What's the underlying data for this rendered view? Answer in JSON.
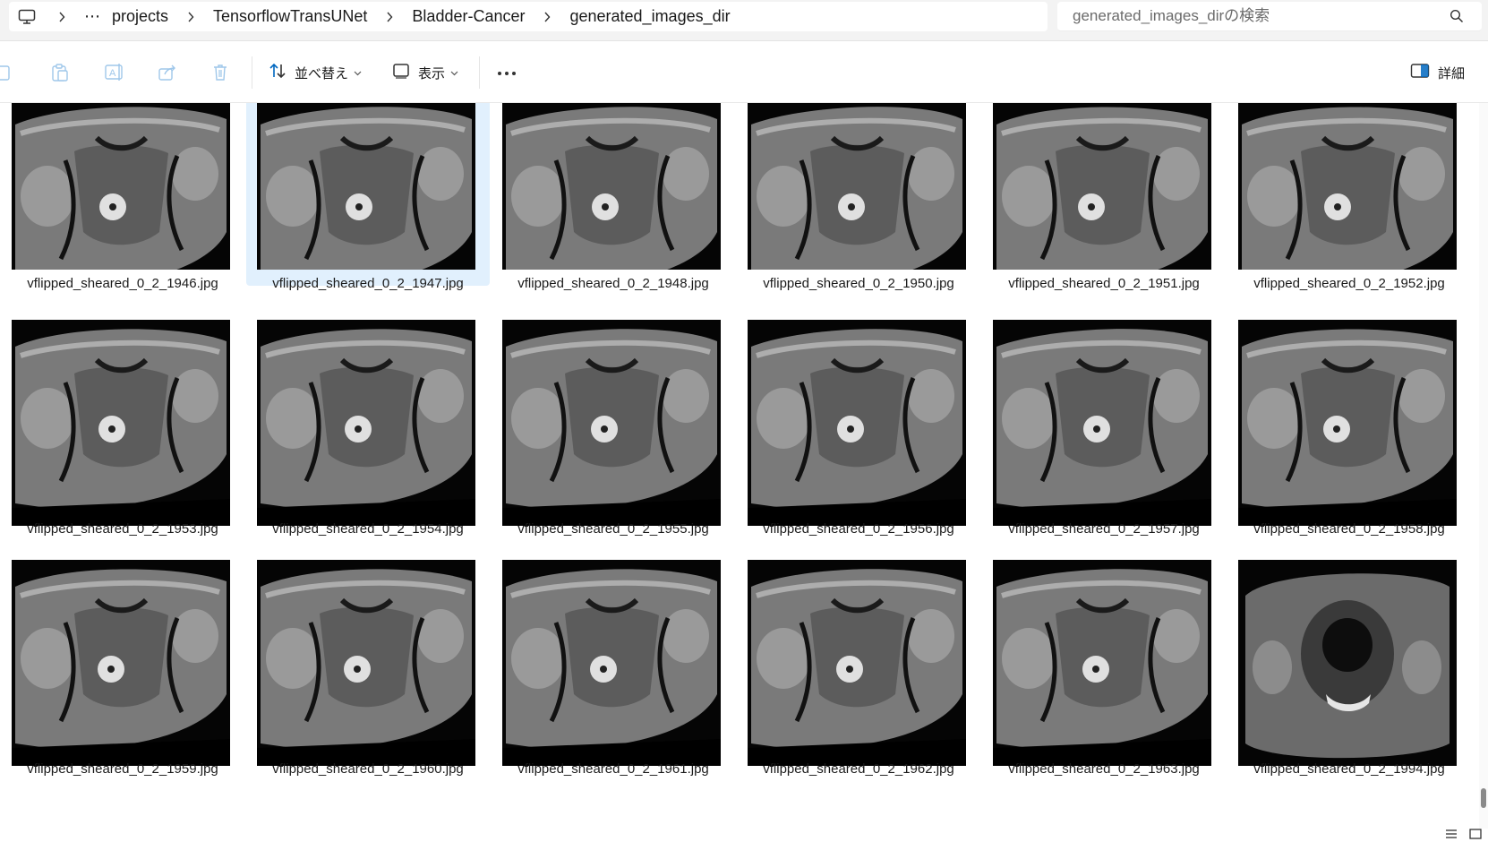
{
  "breadcrumb": {
    "items": [
      "projects",
      "TensorflowTransUNet",
      "Bladder-Cancer",
      "generated_images_dir"
    ]
  },
  "search": {
    "placeholder": "generated_images_dirの検索"
  },
  "toolbar": {
    "sort_label": "並べ替え",
    "view_label": "表示",
    "details_label": "詳細"
  },
  "files": [
    {
      "name": "vflipped_sheared_0_2_1946.jpg"
    },
    {
      "name": "vflipped_sheared_0_2_1947.jpg",
      "selected": true
    },
    {
      "name": "vflipped_sheared_0_2_1948.jpg"
    },
    {
      "name": "vflipped_sheared_0_2_1950.jpg"
    },
    {
      "name": "vflipped_sheared_0_2_1951.jpg"
    },
    {
      "name": "vflipped_sheared_0_2_1952.jpg"
    },
    {
      "name": "vflipped_sheared_0_2_1953.jpg"
    },
    {
      "name": "vflipped_sheared_0_2_1954.jpg"
    },
    {
      "name": "vflipped_sheared_0_2_1955.jpg"
    },
    {
      "name": "vflipped_sheared_0_2_1956.jpg"
    },
    {
      "name": "vflipped_sheared_0_2_1957.jpg"
    },
    {
      "name": "vflipped_sheared_0_2_1958.jpg"
    },
    {
      "name": "vflipped_sheared_0_2_1959.jpg"
    },
    {
      "name": "vflipped_sheared_0_2_1960.jpg"
    },
    {
      "name": "vflipped_sheared_0_2_1961.jpg"
    },
    {
      "name": "vflipped_sheared_0_2_1962.jpg"
    },
    {
      "name": "vflipped_sheared_0_2_1963.jpg"
    },
    {
      "name": "vflipped_sheared_0_2_1994.jpg"
    }
  ],
  "colors": {
    "accent": "#0067c0",
    "selection": "#e1f0fd",
    "chrome": "#f3f3f3"
  },
  "icons": {
    "this_pc": "monitor-icon",
    "separator": "chevron-right-icon",
    "search": "search-icon",
    "sort": "sort-icon",
    "view": "view-icon",
    "more": "more-icon",
    "details": "details-pane-icon"
  }
}
